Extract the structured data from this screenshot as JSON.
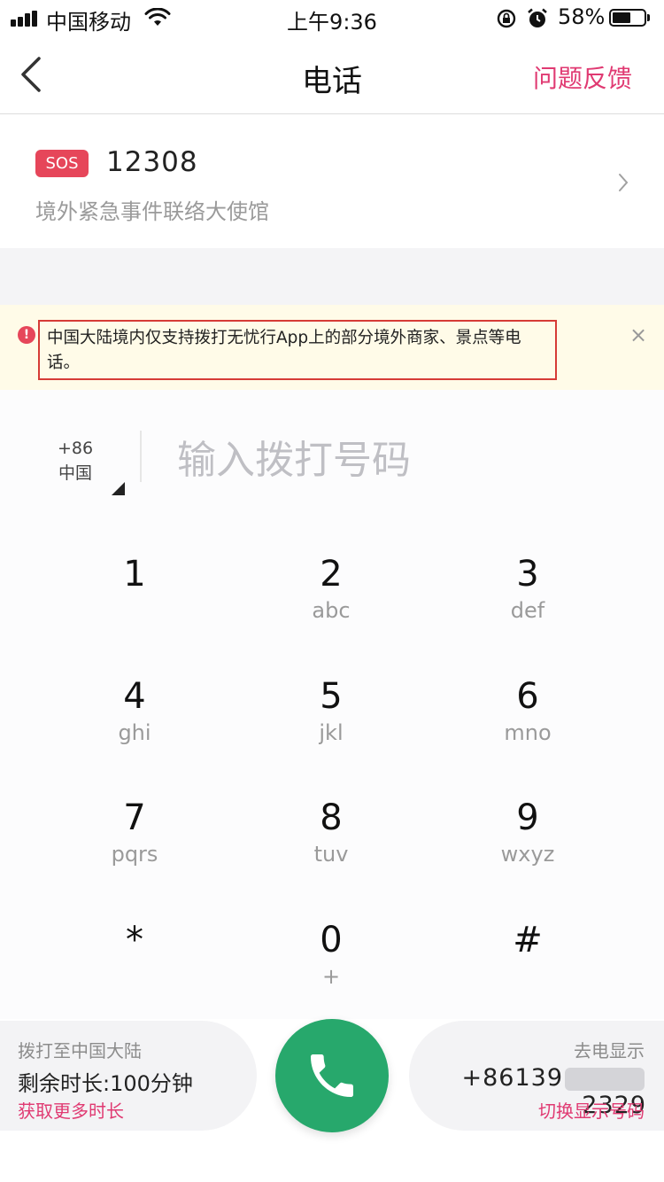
{
  "status_bar": {
    "carrier": "中国移动",
    "time": "上午9:36",
    "battery_percent": "58%",
    "battery_level": 0.58,
    "icons": [
      "signal-icon",
      "wifi-icon",
      "rotation-lock-icon",
      "alarm-icon",
      "battery-icon"
    ]
  },
  "nav": {
    "title": "电话",
    "feedback_label": "问题反馈",
    "back_icon": "chevron-left-icon"
  },
  "sos": {
    "badge": "SOS",
    "number": "12308",
    "description": "境外紧急事件联络大使馆",
    "chevron_icon": "chevron-right-icon"
  },
  "notice": {
    "icon_text": "!",
    "text": "中国大陆境内仅支持拨打无忧行App上的部分境外商家、景点等电话。",
    "close_symbol": "×"
  },
  "dialer": {
    "country_code": "+86",
    "country_name": "中国",
    "input_placeholder": "输入拨打号码",
    "keys": [
      {
        "digit": "1",
        "letters": ""
      },
      {
        "digit": "2",
        "letters": "abc"
      },
      {
        "digit": "3",
        "letters": "def"
      },
      {
        "digit": "4",
        "letters": "ghi"
      },
      {
        "digit": "5",
        "letters": "jkl"
      },
      {
        "digit": "6",
        "letters": "mno"
      },
      {
        "digit": "7",
        "letters": "pqrs"
      },
      {
        "digit": "8",
        "letters": "tuv"
      },
      {
        "digit": "9",
        "letters": "wxyz"
      },
      {
        "digit": "*",
        "letters": ""
      },
      {
        "digit": "0",
        "letters": "+"
      },
      {
        "digit": "#",
        "letters": ""
      }
    ]
  },
  "bottom": {
    "left": {
      "title": "拨打至中国大陆",
      "remaining": "剩余时长:100分钟",
      "link": "获取更多时长"
    },
    "right": {
      "title": "去电显示",
      "number_prefix": "+86139",
      "number_suffix": "2329",
      "link": "切换显示号码"
    },
    "call_icon": "phone-icon"
  },
  "colors": {
    "accent": "#e03a72",
    "sos_badge": "#e6465a",
    "call_button": "#27a86c",
    "notice_bg": "#fffbe8",
    "notice_border": "#d63b36"
  }
}
